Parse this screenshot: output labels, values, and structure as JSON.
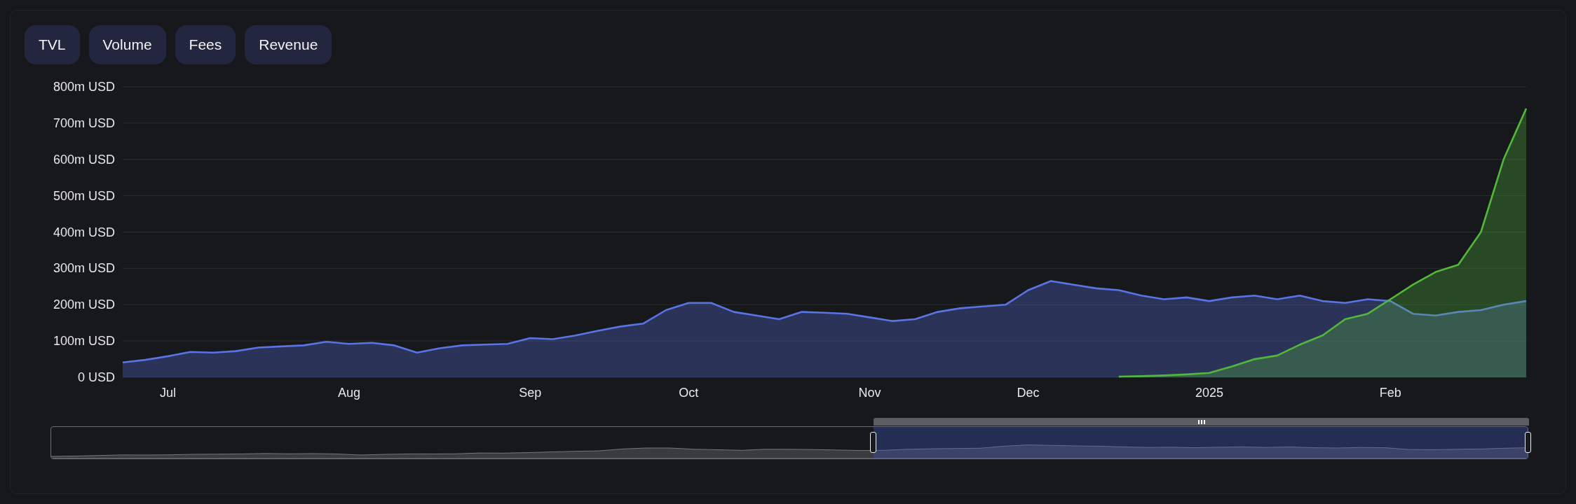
{
  "tabs": [
    {
      "label": "TVL"
    },
    {
      "label": "Volume"
    },
    {
      "label": "Fees"
    },
    {
      "label": "Revenue"
    }
  ],
  "chart": {
    "chart_data": {
      "type": "area",
      "grid": true,
      "stacked": false,
      "ylim": [
        0,
        800
      ],
      "yticks": [
        {
          "value": 0,
          "label": "0 USD"
        },
        {
          "value": 100,
          "label": "100m USD"
        },
        {
          "value": 200,
          "label": "200m USD"
        },
        {
          "value": 300,
          "label": "300m USD"
        },
        {
          "value": 400,
          "label": "400m USD"
        },
        {
          "value": 500,
          "label": "500m USD"
        },
        {
          "value": 600,
          "label": "600m USD"
        },
        {
          "value": 700,
          "label": "700m USD"
        },
        {
          "value": 800,
          "label": "800m USD"
        }
      ],
      "categories": [
        null,
        null,
        "Jul",
        null,
        null,
        null,
        null,
        null,
        null,
        null,
        "Aug",
        null,
        null,
        null,
        null,
        null,
        null,
        null,
        "Sep",
        null,
        null,
        null,
        null,
        null,
        null,
        "Oct",
        null,
        null,
        null,
        null,
        null,
        null,
        null,
        "Nov",
        null,
        null,
        null,
        null,
        null,
        null,
        "Dec",
        null,
        null,
        null,
        null,
        null,
        null,
        null,
        "2025",
        null,
        null,
        null,
        null,
        null,
        null,
        null,
        "Feb",
        null,
        null,
        null,
        null,
        null,
        null
      ],
      "series": [
        {
          "color": "#5a74e6",
          "values": [
            41,
            48,
            58,
            70,
            68,
            72,
            82,
            85,
            88,
            98,
            92,
            95,
            88,
            68,
            80,
            88,
            90,
            92,
            108,
            105,
            115,
            128,
            140,
            148,
            185,
            205,
            205,
            180,
            170,
            160,
            180,
            178,
            175,
            165,
            155,
            160,
            180,
            190,
            195,
            200,
            240,
            265,
            255,
            245,
            240,
            225,
            215,
            220,
            210,
            220,
            225,
            215,
            225,
            210,
            205,
            215,
            210,
            175,
            170,
            180,
            185,
            200,
            210
          ]
        },
        {
          "color": "#52b83a",
          "values": [
            null,
            null,
            null,
            null,
            null,
            null,
            null,
            null,
            null,
            null,
            null,
            null,
            null,
            null,
            null,
            null,
            null,
            null,
            null,
            null,
            null,
            null,
            null,
            null,
            null,
            null,
            null,
            null,
            null,
            null,
            null,
            null,
            null,
            null,
            null,
            null,
            null,
            null,
            null,
            null,
            null,
            null,
            null,
            null,
            2,
            3,
            5,
            8,
            12,
            30,
            50,
            60,
            90,
            115,
            160,
            175,
            215,
            255,
            290,
            310,
            400,
            600,
            740
          ]
        }
      ]
    }
  },
  "navigator": {
    "level": 0.443
  }
}
